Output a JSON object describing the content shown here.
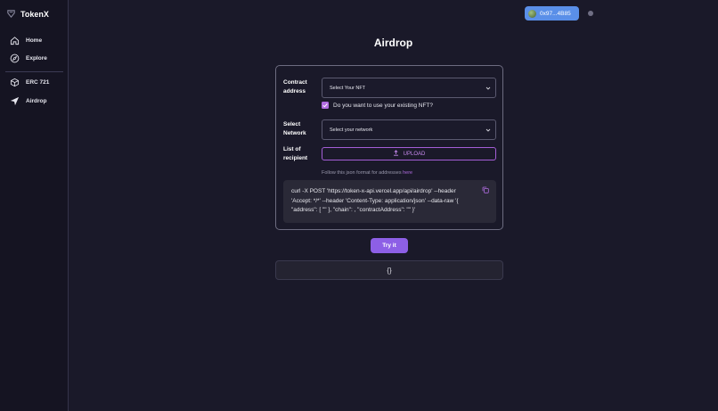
{
  "brand": {
    "name": "TokenX"
  },
  "sidebar": {
    "items": [
      {
        "label": "Home",
        "icon": "home-icon"
      },
      {
        "label": "Explore",
        "icon": "compass-icon"
      },
      {
        "label": "ERC 721",
        "icon": "cube-icon"
      },
      {
        "label": "Airdrop",
        "icon": "send-icon"
      }
    ]
  },
  "header": {
    "wallet_label": "0x97...4B85"
  },
  "main": {
    "title": "Airdrop",
    "form": {
      "contract_label_line1": "Contract",
      "contract_label_line2": "address",
      "contract_select": "Select Your NFT",
      "existing_nft_checkbox": "Do you want to use your existing NFT?",
      "existing_nft_checked": true,
      "network_label_line1": "Select",
      "network_label_line2": "Network",
      "network_select": "Select your network",
      "recipient_label_line1": "List of",
      "recipient_label_line2": "recipient",
      "upload_label": "UPLOAD",
      "hint_text": "Follow this json format for addresses ",
      "hint_link": "here",
      "code_line1": "curl -X POST 'https://token-x-api.vercel.app/api/airdrop' --header",
      "code_line2": "'Accept: */*' --header 'Content-Type: application/json' --data-raw '{",
      "code_line3": "\"address\": [ \"\" ], \"chain\": , \"contractAddress\": \"\" }'"
    },
    "try_button": "Try it",
    "result": "{}"
  },
  "colors": {
    "background": "#1a1929",
    "sidebar": "#151422",
    "accent": "#8d5fe6",
    "wallet": "#5a8fe8",
    "upload": "#c88af0"
  }
}
